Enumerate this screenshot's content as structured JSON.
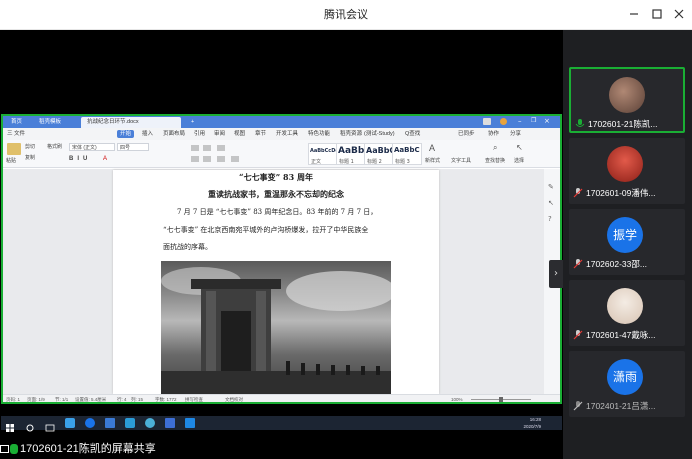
{
  "window": {
    "title": "腾讯会议",
    "controls": [
      "minimize-icon",
      "maximize-icon",
      "close-icon"
    ]
  },
  "wps": {
    "tabs": [
      "首页",
      "稻壳模板",
      "抗战纪念日环节.docx"
    ],
    "menu": [
      "三 文件",
      "开始",
      "插入",
      "页面布局",
      "引用",
      "审阅",
      "视图",
      "章节",
      "开发工具",
      "特色功能",
      "稻壳资源",
      "(测试-Study)",
      "Q查找",
      "已同步",
      "协作",
      "分享"
    ],
    "active_menu": "开始",
    "ribbon": {
      "font_name": "宋体 (正文)",
      "font_size": "四号",
      "paste": "粘贴",
      "cut": "剪切",
      "copy": "复制",
      "format_painter": "格式刷",
      "styles": [
        {
          "preview": "AaBbCcDd",
          "name": "正文"
        },
        {
          "preview": "AaBb",
          "name": "标题 1"
        },
        {
          "preview": "AaBbC",
          "name": "标题 2"
        },
        {
          "preview": "AaBbC",
          "name": "标题 3"
        }
      ],
      "new_style": "新样式",
      "text_tools": "文字工具",
      "find_replace": "查找替换",
      "select": "选择"
    },
    "document": {
      "title": "“七七事变” 83 周年",
      "subtitle": "重读抗战家书，重温那永不忘却的纪念",
      "para1": "7 月 7 日是 “七七事变” 83 周年纪念日。83 年前的 7 月 7 日，",
      "para2": "“七七事变” 在北京西南宛平城外的卢沟桥爆发，拉开了中华民族全",
      "para3": "面抗战的序幕。"
    },
    "status": {
      "page": "页码: 1",
      "pages": "页面: 1/9",
      "section": "节: 1/1",
      "position": "设置值: 5.4厘米",
      "line": "行: 4",
      "col": "列: 15",
      "words": "字数: 1772",
      "spell": "拼写检查",
      "doc_check": "文档校对",
      "zoom": "100%"
    }
  },
  "taskbar": {
    "time": "16:28",
    "date": "2020/7/9"
  },
  "share_caption": "1702601-21陈凯的屏幕共享",
  "participants": [
    {
      "name": "1702601-21陈凯...",
      "avatar_text": "",
      "avatar_color": "#8a6a5a",
      "speaking": true,
      "mic": "mic-on-icon"
    },
    {
      "name": "1702601-09潘伟...",
      "avatar_text": "",
      "avatar_color": "#c0392b",
      "speaking": false,
      "mic": "mic-muted-icon"
    },
    {
      "name": "1702602-33邵...",
      "avatar_text": "振学",
      "avatar_color": "#1a73e8",
      "speaking": false,
      "mic": "mic-muted-icon"
    },
    {
      "name": "1702601-47戴咏...",
      "avatar_text": "",
      "avatar_color": "#e8d8cc",
      "speaking": false,
      "mic": "mic-muted-icon"
    },
    {
      "name": "1702401-21吕潇...",
      "avatar_text": "潇雨",
      "avatar_color": "#1a73e8",
      "speaking": false,
      "mic": "mic-muted-icon"
    }
  ],
  "colors": {
    "accent_green": "#1aae34",
    "wps_blue": "#4a7fd8",
    "avatar_blue": "#1a73e8"
  }
}
